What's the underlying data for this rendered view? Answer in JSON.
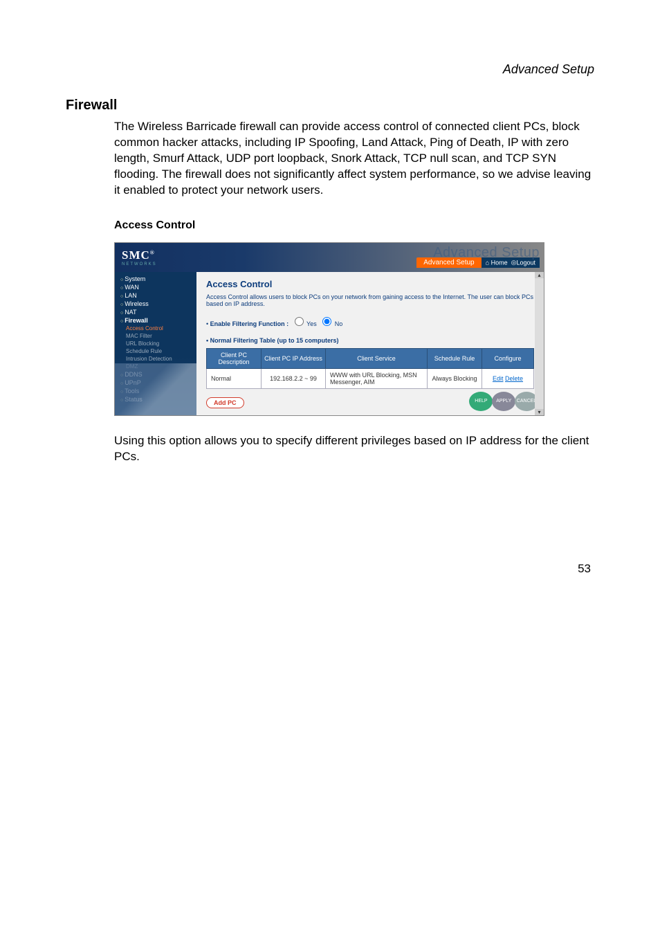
{
  "doc": {
    "running_header": "Advanced Setup",
    "section_title": "Firewall",
    "body_paragraph": "The Wireless Barricade firewall can provide access control of connected client PCs, block common hacker attacks, including IP Spoofing, Land Attack, Ping of Death, IP with zero length, Smurf Attack, UDP port loopback, Snork Attack, TCP null scan, and TCP SYN flooding. The firewall does not significantly affect system performance, so we advise leaving it enabled to protect your network users.",
    "subheading": "Access Control",
    "caption": "Using this option allows you to specify different privileges based on IP address for the client PCs.",
    "page_number": "53"
  },
  "screenshot": {
    "logo_text": "SMC",
    "logo_sub": "NETWORKS",
    "advanced_ghost": "Advanced Setup",
    "tab_text": "Advanced Setup",
    "home_icon": "⌂",
    "home_label": "Home",
    "logout_label": "Logout",
    "sidebar": {
      "items": [
        "System",
        "WAN",
        "LAN",
        "Wireless",
        "NAT",
        "Firewall"
      ],
      "firewall_sub": [
        "Access Control",
        "MAC Filter",
        "URL Blocking",
        "Schedule Rule",
        "Intrusion Detection",
        "DMZ"
      ],
      "after": [
        "DDNS",
        "UPnP",
        "Tools",
        "Status"
      ]
    },
    "content": {
      "heading": "Access Control",
      "description": "Access Control allows users to block PCs on your network from gaining access to the Internet. The user can block PCs based on IP address.",
      "filter_label": "Enable Filtering Function :",
      "filter_yes": "Yes",
      "filter_no": "No",
      "table_title": "Normal Filtering Table (up to 15 computers)",
      "columns": {
        "desc": "Client PC Description",
        "ip": "Client PC IP Address",
        "service": "Client Service",
        "sched": "Schedule Rule",
        "conf": "Configure"
      },
      "row": {
        "desc": "Normal",
        "ip": "192.168.2.2 ~ 99",
        "service": "WWW with URL Blocking,  MSN Messenger,  AIM",
        "sched": "Always Blocking",
        "edit": "Edit",
        "delete": "Delete"
      },
      "add_pc": "Add PC",
      "buttons": {
        "help": "HELP",
        "apply": "APPLY",
        "cancel": "CANCEL"
      }
    }
  }
}
